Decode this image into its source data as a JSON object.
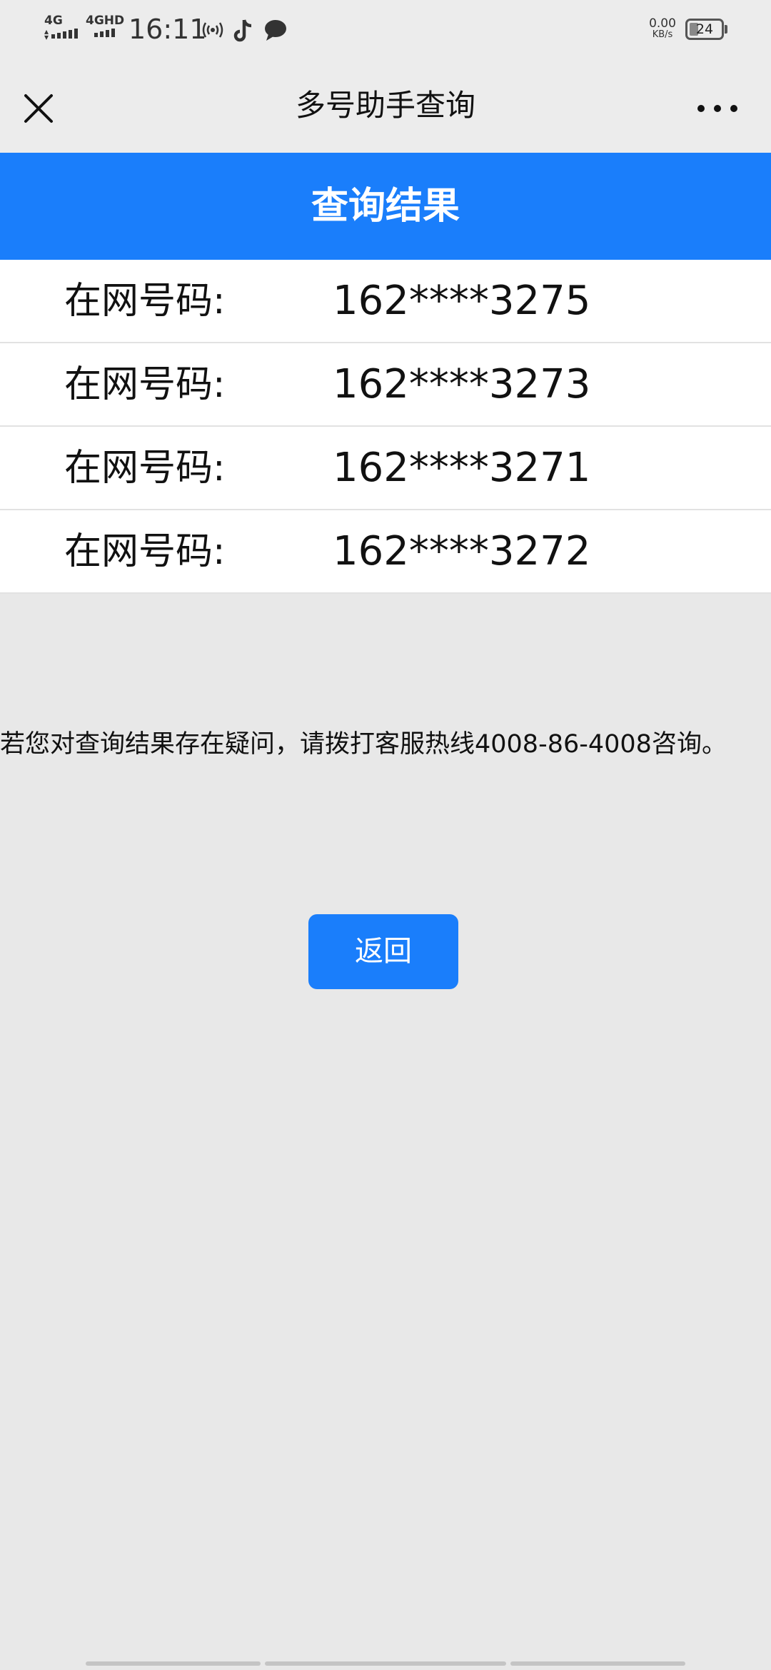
{
  "status_bar": {
    "network_1": "4G",
    "network_2": "4GHD",
    "time": "16:11",
    "speed_value": "0.00",
    "speed_unit": "KB/s",
    "battery_level": "24"
  },
  "title_bar": {
    "title": "多号助手查询"
  },
  "header": {
    "title": "查询结果"
  },
  "rows": [
    {
      "label": "在网号码:",
      "number": "162****3275"
    },
    {
      "label": "在网号码:",
      "number": "162****3273"
    },
    {
      "label": "在网号码:",
      "number": "162****3271"
    },
    {
      "label": "在网号码:",
      "number": "162****3272"
    }
  ],
  "notice": "若您对查询结果存在疑问，请拨打客服热线4008-86-4008咨询。",
  "back_button": "返回",
  "colors": {
    "accent": "#1a7efb",
    "background": "#e8e8e8",
    "title_bar": "#ececec"
  }
}
